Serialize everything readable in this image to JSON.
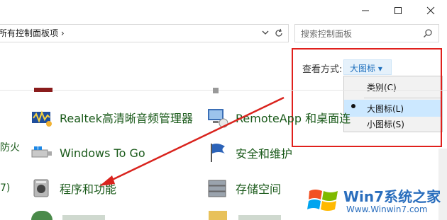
{
  "window": {
    "minimize_icon": "minimize-icon",
    "maximize_icon": "maximize-icon",
    "close_icon": "close-icon"
  },
  "address_bar": {
    "path_text": "所有控制面板项  ›",
    "dropdown_icon": "chevron-down-icon",
    "refresh_icon": "refresh-icon"
  },
  "search": {
    "placeholder": "搜索控制面板",
    "icon": "search-icon"
  },
  "view_by": {
    "label": "查看方式:",
    "selected": "大图标 ▾"
  },
  "view_menu": {
    "items": [
      {
        "label": "类别(C)",
        "selected": false
      },
      {
        "label": "大图标(L)",
        "selected": true
      },
      {
        "label": "小图标(S)",
        "selected": false
      }
    ]
  },
  "items": {
    "realtek": "Realtek高清晰音频管理器",
    "remoteapp": "RemoteApp 和桌面连",
    "windows_to_go": "Windows To Go",
    "security": "安全和维护",
    "programs": "程序和功能",
    "storage": "存储空间"
  },
  "left_partial": {
    "line1": "防火",
    "line2": "7)"
  },
  "watermark": {
    "main": "Win7系统之家",
    "sub": "Www.Winwin7.com"
  },
  "colors": {
    "highlight_red": "#e0201c",
    "link_green": "#1a5a1a",
    "selected_blue": "#cce8ff",
    "accent_blue": "#1e6fbd"
  }
}
